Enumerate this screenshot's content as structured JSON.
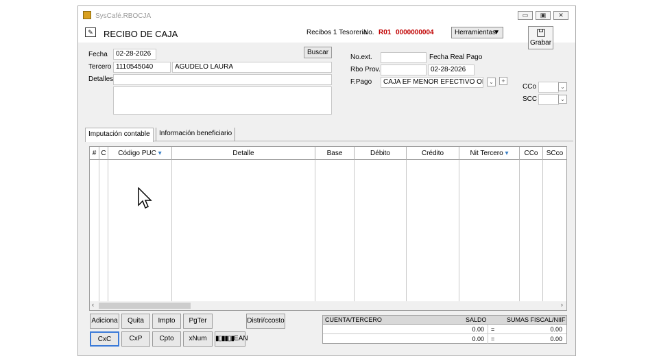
{
  "window": {
    "title": "SysCafé.RBOCJA",
    "buttons": {
      "minimize": "▭",
      "maximize": "▣",
      "close": "✕"
    }
  },
  "header": {
    "form_title": "RECIBO DE CAJA",
    "recibos_label": "Recibos 1 Tesoreria",
    "no_label": "No.",
    "prefix": "R01",
    "number": "0000000004",
    "herramientas_label": "Herramientas",
    "grabar_label": "Grabar"
  },
  "form": {
    "fecha_label": "Fecha",
    "fecha_value": "02-28-2026",
    "buscar_label": "Buscar",
    "tercero_label": "Tercero",
    "tercero_id": "1110545040",
    "tercero_name": "AGUDELO LAURA",
    "detalles_label": "Detalles",
    "detalles_value": "",
    "noext_label": "No.ext.",
    "noext_value": "",
    "fecha_real_label": "Fecha Real Pago",
    "rbo_prov_label": "Rbo Prov.",
    "rbo_prov_value": "",
    "fecha_real_value": "02-28-2026",
    "fpago_label": "F.Pago",
    "fpago_value": "CAJA EF  MENOR EFECTIVO OFICIN",
    "cco_label": "CCo",
    "scc_label": "SCC"
  },
  "tabs": [
    {
      "label": "Imputación contable"
    },
    {
      "label": "Información beneficiario"
    }
  ],
  "grid": {
    "columns": [
      "#",
      "C",
      "Código PUC",
      "Detalle",
      "Base",
      "Débito",
      "Crédito",
      "Nit Tercero",
      "CCo",
      "SCco"
    ]
  },
  "buttons": {
    "adiciona": "Adiciona",
    "quita": "Quita",
    "impto": "Impto",
    "pgter": "PgTer",
    "distri": "Distri/ccosto",
    "cxc": "CxC",
    "cxp": "CxP",
    "cpto": "Cpto",
    "xnum": "xNum",
    "ean": "EAN"
  },
  "totals": {
    "col1": "CUENTA/TERCERO",
    "col2": "SALDO",
    "col3": "SUMAS FISCAL/NIIF",
    "row1_saldo": "0.00",
    "row1_eq": "=",
    "row1_sumas": "0.00",
    "row2_saldo": "0.00",
    "row2_eq": "=",
    "row2_sumas": "0.00"
  }
}
